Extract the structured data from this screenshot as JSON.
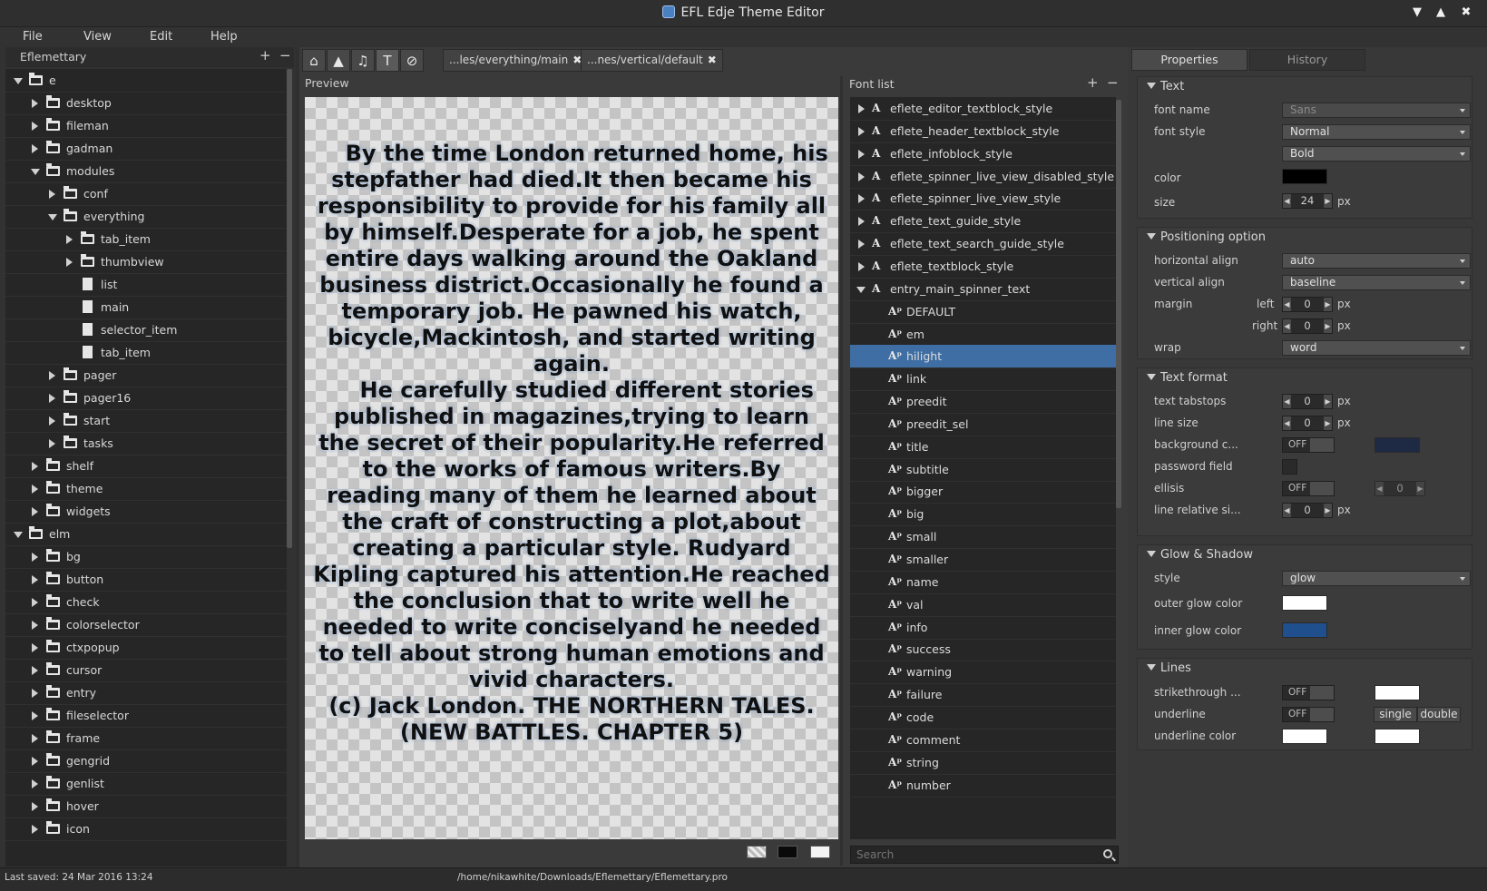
{
  "window": {
    "title": "EFL Edje Theme Editor",
    "buttons": [
      "▼",
      "▲",
      "✖"
    ]
  },
  "menu": [
    "File",
    "View",
    "Edit",
    "Help"
  ],
  "left_panel": {
    "project": "Eflemettary",
    "add": "+",
    "remove": "−",
    "tree": [
      {
        "label": "e",
        "depth": 0,
        "type": "folder",
        "expanded": true
      },
      {
        "label": "desktop",
        "depth": 1,
        "type": "folder",
        "expanded": false
      },
      {
        "label": "fileman",
        "depth": 1,
        "type": "folder",
        "expanded": false
      },
      {
        "label": "gadman",
        "depth": 1,
        "type": "folder",
        "expanded": false
      },
      {
        "label": "modules",
        "depth": 1,
        "type": "folder",
        "expanded": true
      },
      {
        "label": "conf",
        "depth": 2,
        "type": "folder",
        "expanded": false
      },
      {
        "label": "everything",
        "depth": 2,
        "type": "folder",
        "expanded": true
      },
      {
        "label": "tab_item",
        "depth": 3,
        "type": "folder",
        "expanded": false
      },
      {
        "label": "thumbview",
        "depth": 3,
        "type": "folder",
        "expanded": false
      },
      {
        "label": "list",
        "depth": 3,
        "type": "file"
      },
      {
        "label": "main",
        "depth": 3,
        "type": "file"
      },
      {
        "label": "selector_item",
        "depth": 3,
        "type": "file"
      },
      {
        "label": "tab_item",
        "depth": 3,
        "type": "file"
      },
      {
        "label": "pager",
        "depth": 2,
        "type": "folder",
        "expanded": false
      },
      {
        "label": "pager16",
        "depth": 2,
        "type": "folder",
        "expanded": false
      },
      {
        "label": "start",
        "depth": 2,
        "type": "folder",
        "expanded": false
      },
      {
        "label": "tasks",
        "depth": 2,
        "type": "folder",
        "expanded": false
      },
      {
        "label": "shelf",
        "depth": 1,
        "type": "folder",
        "expanded": false
      },
      {
        "label": "theme",
        "depth": 1,
        "type": "folder",
        "expanded": false
      },
      {
        "label": "widgets",
        "depth": 1,
        "type": "folder",
        "expanded": false
      },
      {
        "label": "elm",
        "depth": 0,
        "type": "folder",
        "expanded": true
      },
      {
        "label": "bg",
        "depth": 1,
        "type": "folder",
        "expanded": false
      },
      {
        "label": "button",
        "depth": 1,
        "type": "folder",
        "expanded": false
      },
      {
        "label": "check",
        "depth": 1,
        "type": "folder",
        "expanded": false
      },
      {
        "label": "colorselector",
        "depth": 1,
        "type": "folder",
        "expanded": false
      },
      {
        "label": "ctxpopup",
        "depth": 1,
        "type": "folder",
        "expanded": false
      },
      {
        "label": "cursor",
        "depth": 1,
        "type": "folder",
        "expanded": false
      },
      {
        "label": "entry",
        "depth": 1,
        "type": "folder",
        "expanded": false
      },
      {
        "label": "fileselector",
        "depth": 1,
        "type": "folder",
        "expanded": false
      },
      {
        "label": "frame",
        "depth": 1,
        "type": "folder",
        "expanded": false
      },
      {
        "label": "gengrid",
        "depth": 1,
        "type": "folder",
        "expanded": false
      },
      {
        "label": "genlist",
        "depth": 1,
        "type": "folder",
        "expanded": false
      },
      {
        "label": "hover",
        "depth": 1,
        "type": "folder",
        "expanded": false
      },
      {
        "label": "icon",
        "depth": 1,
        "type": "folder",
        "expanded": false
      }
    ]
  },
  "toolbar": {
    "icons": [
      "home-icon",
      "image-icon",
      "sound-icon",
      "text-icon",
      "colorclass-icon"
    ],
    "glyphs": [
      "⌂",
      "▲",
      "♫",
      "T",
      "⊘"
    ],
    "tabs": [
      {
        "label": "...les/everything/main",
        "close": "✖"
      },
      {
        "label": "...nes/vertical/default",
        "close": "✖"
      }
    ]
  },
  "preview": {
    "label": "Preview",
    "text": "    By the time London returned home, his stepfather had died.It then became his responsibility to provide for his family all by himself.Desperate for a job, he spent entire days walking around the Oakland business district.Occasionally he found a temporary job. He pawned his watch, bicycle,Mackintosh, and started writing again.\n    He carefully studied different stories published in magazines,trying to learn the secret of their popularity.He referred to the works of famous writers.By reading many of them he learned about the craft of constructing a plot,about creating a particular style. Rudyard Kipling captured his attention.He reached the conclusion that to write well he needed to write conciselyand he needed to tell about strong human emotions and vivid characters.\n(c) Jack London. THE NORTHERN TALES. (NEW BATTLES. CHAPTER 5)",
    "bg_options": [
      "checker",
      "black",
      "white"
    ]
  },
  "font_list": {
    "title": "Font list",
    "add": "+",
    "remove": "−",
    "items": [
      {
        "label": "eflete_editor_textblock_style",
        "level": 0,
        "icon": "A",
        "arrow": "right"
      },
      {
        "label": "eflete_header_textblock_style",
        "level": 0,
        "icon": "A",
        "arrow": "right"
      },
      {
        "label": "eflete_infoblock_style",
        "level": 0,
        "icon": "A",
        "arrow": "right"
      },
      {
        "label": "eflete_spinner_live_view_disabled_style",
        "level": 0,
        "icon": "A",
        "arrow": "right"
      },
      {
        "label": "eflete_spinner_live_view_style",
        "level": 0,
        "icon": "A",
        "arrow": "right"
      },
      {
        "label": "eflete_text_guide_style",
        "level": 0,
        "icon": "A",
        "arrow": "right"
      },
      {
        "label": "eflete_text_search_guide_style",
        "level": 0,
        "icon": "A",
        "arrow": "right"
      },
      {
        "label": "eflete_textblock_style",
        "level": 0,
        "icon": "A",
        "arrow": "right"
      },
      {
        "label": "entry_main_spinner_text",
        "level": 0,
        "icon": "A",
        "arrow": "down"
      },
      {
        "label": "DEFAULT",
        "level": 1,
        "icon": "Aᵖ"
      },
      {
        "label": "em",
        "level": 1,
        "icon": "Aᵖ"
      },
      {
        "label": "hilight",
        "level": 1,
        "icon": "Aᵖ",
        "selected": true
      },
      {
        "label": "link",
        "level": 1,
        "icon": "Aᵖ"
      },
      {
        "label": "preedit",
        "level": 1,
        "icon": "Aᵖ"
      },
      {
        "label": "preedit_sel",
        "level": 1,
        "icon": "Aᵖ"
      },
      {
        "label": "title",
        "level": 1,
        "icon": "Aᵖ"
      },
      {
        "label": "subtitle",
        "level": 1,
        "icon": "Aᵖ"
      },
      {
        "label": "bigger",
        "level": 1,
        "icon": "Aᵖ"
      },
      {
        "label": "big",
        "level": 1,
        "icon": "Aᵖ"
      },
      {
        "label": "small",
        "level": 1,
        "icon": "Aᵖ"
      },
      {
        "label": "smaller",
        "level": 1,
        "icon": "Aᵖ"
      },
      {
        "label": "name",
        "level": 1,
        "icon": "Aᵖ"
      },
      {
        "label": "val",
        "level": 1,
        "icon": "Aᵖ"
      },
      {
        "label": "info",
        "level": 1,
        "icon": "Aᵖ"
      },
      {
        "label": "success",
        "level": 1,
        "icon": "Aᵖ"
      },
      {
        "label": "warning",
        "level": 1,
        "icon": "Aᵖ"
      },
      {
        "label": "failure",
        "level": 1,
        "icon": "Aᵖ"
      },
      {
        "label": "code",
        "level": 1,
        "icon": "Aᵖ"
      },
      {
        "label": "comment",
        "level": 1,
        "icon": "Aᵖ"
      },
      {
        "label": "string",
        "level": 1,
        "icon": "Aᵖ"
      },
      {
        "label": "number",
        "level": 1,
        "icon": "Aᵖ"
      }
    ],
    "search_placeholder": "Search"
  },
  "properties": {
    "tabs": [
      "Properties",
      "History"
    ],
    "text_section": {
      "title": "Text",
      "font_name_label": "font name",
      "font_name": "Sans",
      "font_style_label": "font style",
      "font_style": "Normal",
      "font_weight": "Bold",
      "color_label": "color",
      "color": "#000000",
      "size_label": "size",
      "size": "24",
      "unit": "px"
    },
    "positioning": {
      "title": "Positioning option",
      "halign_label": "horizontal align",
      "halign": "auto",
      "valign_label": "vertical align",
      "valign": "baseline",
      "margin_label": "margin",
      "left_label": "left",
      "left": "0",
      "right_label": "right",
      "right": "0",
      "wrap_label": "wrap",
      "wrap": "word"
    },
    "format": {
      "title": "Text format",
      "tabstops_label": "text tabstops",
      "tabstops": "0",
      "linesize_label": "line size",
      "linesize": "0",
      "bgcolor_label": "background c...",
      "bgcolor_toggle": "OFF",
      "bgcolor": "#1e2a44",
      "password_label": "password field",
      "ellipsis_label": "ellisis",
      "ellipsis_toggle": "OFF",
      "ellipsis": "0",
      "linerel_label": "line relative si...",
      "linerel": "0"
    },
    "glow": {
      "title": "Glow & Shadow",
      "style_label": "style",
      "style": "glow",
      "outer_label": "outer glow color",
      "outer": "#ffffff",
      "inner_label": "inner glow color",
      "inner": "#1f4f8c"
    },
    "lines": {
      "title": "Lines",
      "strike_label": "strikethrough ...",
      "strike_toggle": "OFF",
      "strike_color": "#ffffff",
      "underline_label": "underline",
      "underline_toggle": "OFF",
      "single": "single",
      "double": "double",
      "underline_color_label": "underline color",
      "underline_color": "#ffffff",
      "underline_color2": "#ffffff"
    }
  },
  "status": {
    "saved": "Last saved: 24 Mar 2016 13:24",
    "path": "/home/nikawhite/Downloads/Eflemettary/Eflemettary.pro"
  }
}
